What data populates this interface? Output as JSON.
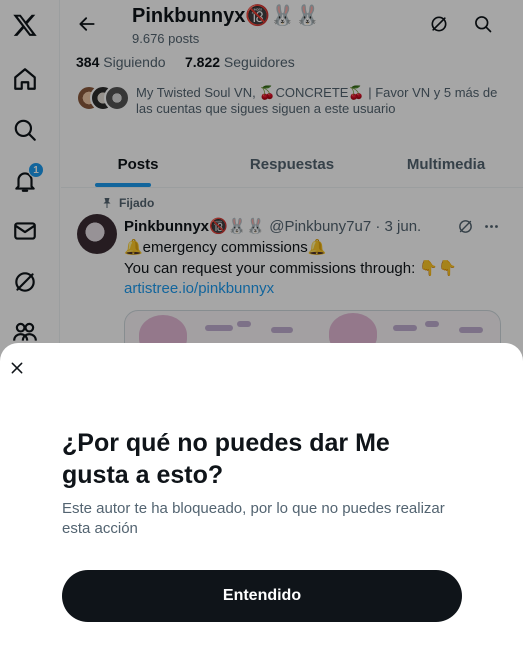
{
  "profile": {
    "name": "Pinkbunnyx🔞🐰🐰",
    "post_count": "9.676 posts",
    "following_count": "384",
    "following_label": "Siguiendo",
    "followers_count": "7.822",
    "followers_label": "Seguidores",
    "followed_by_text": "My Twisted Soul VN, 🍒CONCRETE🍒 | Favor VN y 5 más de las cuentas que sigues siguen a este usuario"
  },
  "header": {
    "back_icon": "arrow-left-icon",
    "grok_icon": "grok-icon",
    "search_icon": "search-icon"
  },
  "nav": {
    "items": [
      {
        "icon": "x-logo-icon"
      },
      {
        "icon": "home-icon"
      },
      {
        "icon": "search-icon"
      },
      {
        "icon": "bell-icon",
        "badge": "1"
      },
      {
        "icon": "mail-icon"
      },
      {
        "icon": "grok-icon"
      },
      {
        "icon": "communities-icon"
      }
    ]
  },
  "tabs": [
    {
      "label": "Posts",
      "active": true
    },
    {
      "label": "Respuestas",
      "active": false
    },
    {
      "label": "Multimedia",
      "active": false
    }
  ],
  "tweet": {
    "pinned_label": "Fijado",
    "author_name": "Pinkbunnyx🔞🐰🐰",
    "author_handle": "@Pinkbuny7u7",
    "separator": "·",
    "date": "3 jun.",
    "line1": "🔔emergency commissions🔔",
    "line2": "You can request your commissions through: 👇👇",
    "link": "artistree.io/pinkbunnyx"
  },
  "sheet": {
    "title": "¿Por qué no puedes dar Me gusta a esto?",
    "body": "Este autor te ha bloqueado, por lo que no puedes realizar esta acción",
    "button": "Entendido"
  },
  "colors": {
    "accent": "#1d9bf0",
    "text": "#0f1419",
    "secondary": "#536471",
    "button_bg": "#0f1419"
  }
}
